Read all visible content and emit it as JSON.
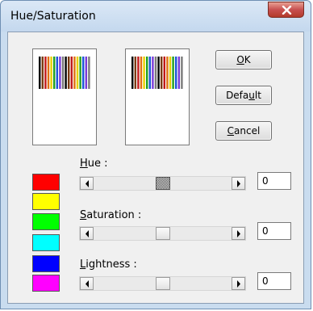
{
  "window": {
    "title": "Hue/Saturation"
  },
  "buttons": {
    "ok": {
      "pre": "",
      "u": "O",
      "post": "K"
    },
    "default": {
      "pre": "Defa",
      "u": "u",
      "post": "lt"
    },
    "cancel": {
      "pre": "",
      "u": "C",
      "post": "ancel"
    }
  },
  "swatches": [
    "#ff0000",
    "#ffff00",
    "#00ff00",
    "#00ffff",
    "#0000ff",
    "#ff00ff"
  ],
  "sliders": {
    "hue": {
      "u": "H",
      "rest": "ue :",
      "value": "0",
      "position": 0.5,
      "focused": true
    },
    "saturation": {
      "u": "S",
      "rest": "aturation :",
      "value": "0",
      "position": 0.5,
      "focused": false
    },
    "lightness": {
      "u": "L",
      "rest": "ightness :",
      "value": "0",
      "position": 0.5,
      "focused": false
    }
  },
  "preview_colors": [
    "#000000",
    "#7a3a10",
    "#c01818",
    "#e07010",
    "#e8d000",
    "#20a020",
    "#1c56d8",
    "#7a3ad8",
    "#7a7a7a"
  ]
}
